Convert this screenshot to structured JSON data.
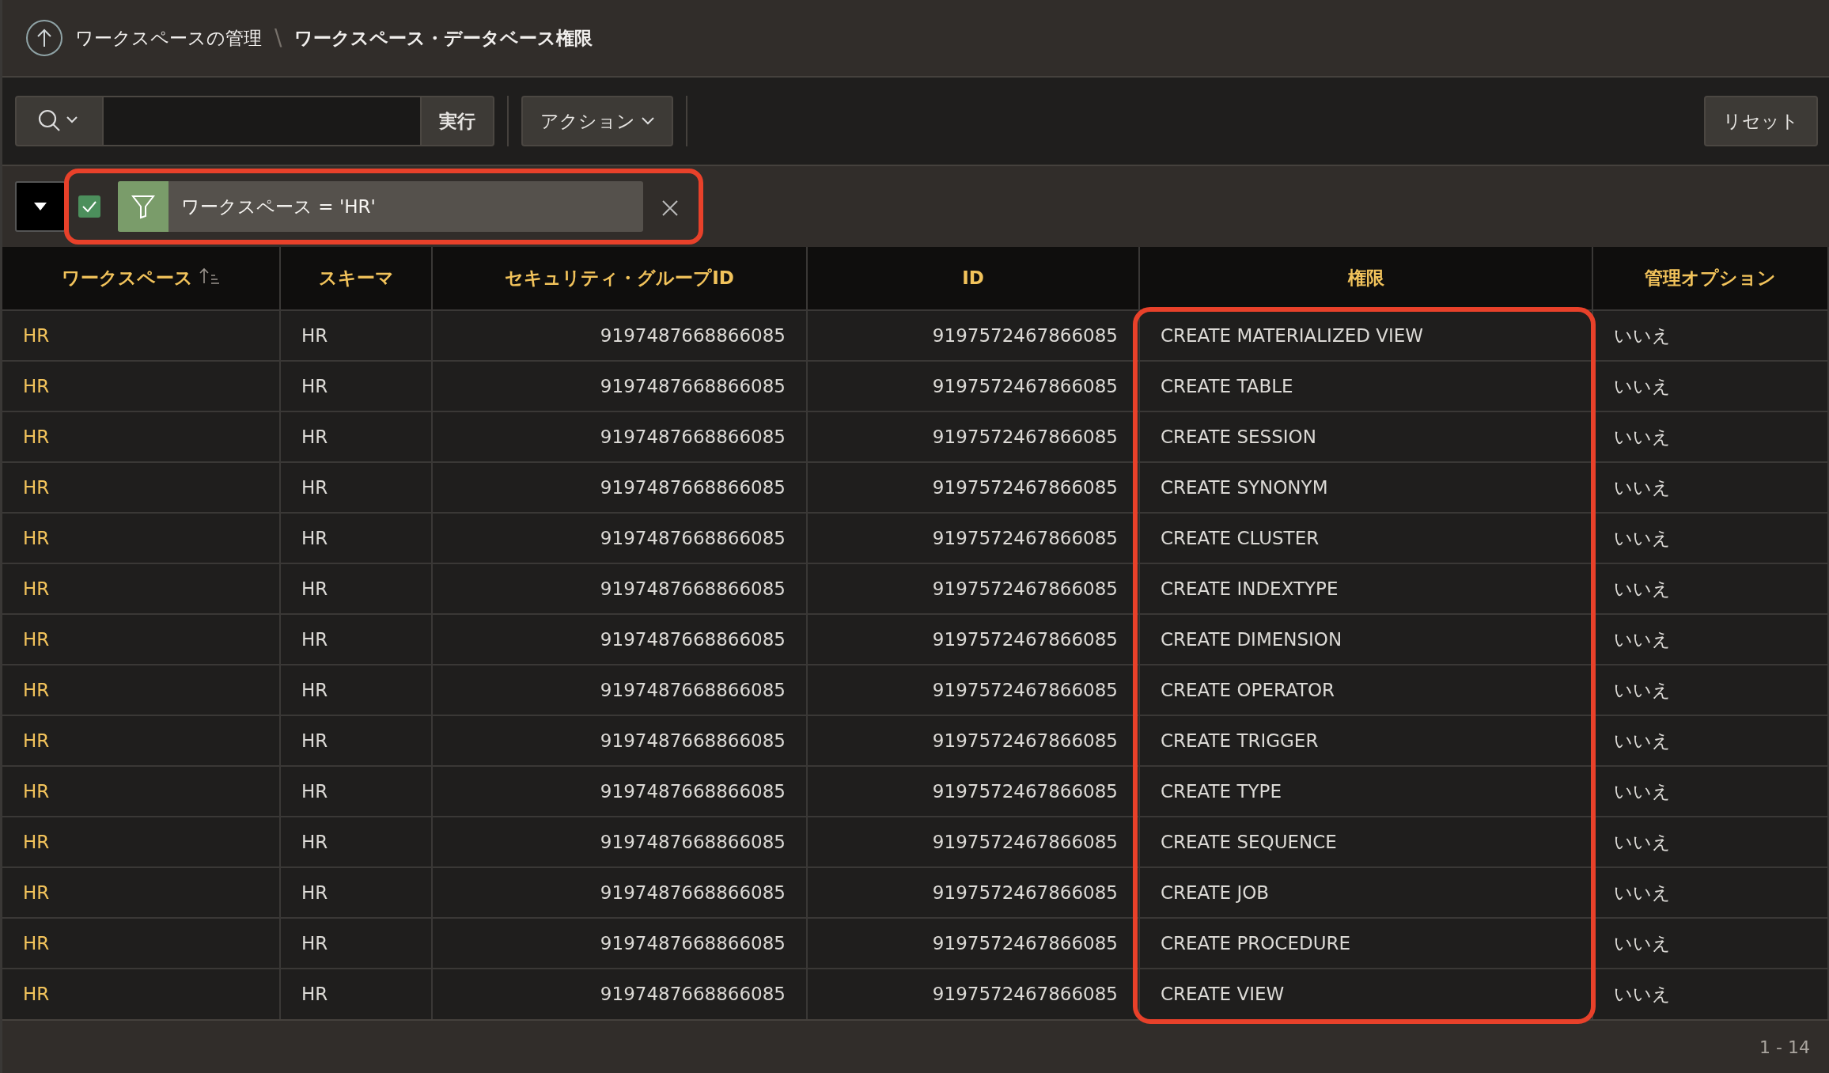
{
  "breadcrumb": {
    "parent": "ワークスペースの管理",
    "separator": "\\",
    "current": "ワークスペース・データベース権限"
  },
  "toolbar": {
    "go_button": "実行",
    "actions_button": "アクション",
    "reset_button": "リセット"
  },
  "filter": {
    "enabled": true,
    "text": "ワークスペース = 'HR'",
    "highlighted": true
  },
  "table": {
    "columns": [
      {
        "label": "ワークスペース",
        "sorted": true,
        "highlighted": false
      },
      {
        "label": "スキーマ",
        "sorted": false,
        "highlighted": false
      },
      {
        "label": "セキュリティ・グループID",
        "sorted": false,
        "highlighted": false
      },
      {
        "label": "ID",
        "sorted": false,
        "highlighted": false
      },
      {
        "label": "権限",
        "sorted": false,
        "highlighted": true
      },
      {
        "label": "管理オプション",
        "sorted": false,
        "highlighted": false
      }
    ],
    "rows": [
      [
        "HR",
        "HR",
        "9197487668866085",
        "9197572467866085",
        "CREATE MATERIALIZED VIEW",
        "いいえ"
      ],
      [
        "HR",
        "HR",
        "9197487668866085",
        "9197572467866085",
        "CREATE TABLE",
        "いいえ"
      ],
      [
        "HR",
        "HR",
        "9197487668866085",
        "9197572467866085",
        "CREATE SESSION",
        "いいえ"
      ],
      [
        "HR",
        "HR",
        "9197487668866085",
        "9197572467866085",
        "CREATE SYNONYM",
        "いいえ"
      ],
      [
        "HR",
        "HR",
        "9197487668866085",
        "9197572467866085",
        "CREATE CLUSTER",
        "いいえ"
      ],
      [
        "HR",
        "HR",
        "9197487668866085",
        "9197572467866085",
        "CREATE INDEXTYPE",
        "いいえ"
      ],
      [
        "HR",
        "HR",
        "9197487668866085",
        "9197572467866085",
        "CREATE DIMENSION",
        "いいえ"
      ],
      [
        "HR",
        "HR",
        "9197487668866085",
        "9197572467866085",
        "CREATE OPERATOR",
        "いいえ"
      ],
      [
        "HR",
        "HR",
        "9197487668866085",
        "9197572467866085",
        "CREATE TRIGGER",
        "いいえ"
      ],
      [
        "HR",
        "HR",
        "9197487668866085",
        "9197572467866085",
        "CREATE TYPE",
        "いいえ"
      ],
      [
        "HR",
        "HR",
        "9197487668866085",
        "9197572467866085",
        "CREATE SEQUENCE",
        "いいえ"
      ],
      [
        "HR",
        "HR",
        "9197487668866085",
        "9197572467866085",
        "CREATE JOB",
        "いいえ"
      ],
      [
        "HR",
        "HR",
        "9197487668866085",
        "9197572467866085",
        "CREATE PROCEDURE",
        "いいえ"
      ],
      [
        "HR",
        "HR",
        "9197487668866085",
        "9197572467866085",
        "CREATE VIEW",
        "いいえ"
      ]
    ]
  },
  "pagination": "1 - 14"
}
